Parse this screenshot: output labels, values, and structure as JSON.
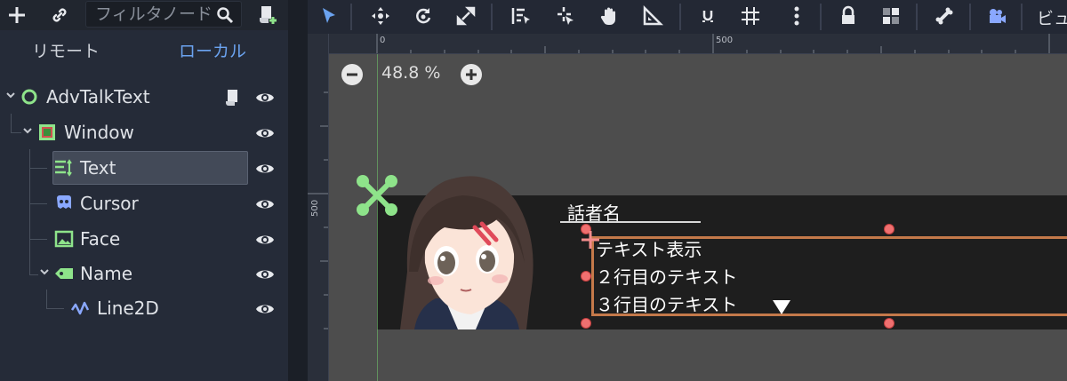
{
  "dock": {
    "filter_placeholder": "フィルタノード",
    "tabs": {
      "remote": "リモート",
      "local": "ローカル"
    },
    "tree": [
      {
        "label": "AdvTalkText",
        "icon": "node-icon"
      },
      {
        "label": "Window",
        "icon": "nine-patch-icon"
      },
      {
        "label": "Text",
        "icon": "rich-text-label-icon"
      },
      {
        "label": "Cursor",
        "icon": "cursor-sprite-icon"
      },
      {
        "label": "Face",
        "icon": "texture-rect-icon"
      },
      {
        "label": "Name",
        "icon": "label-icon"
      },
      {
        "label": "Line2D",
        "icon": "line2d-icon"
      }
    ]
  },
  "viewport": {
    "zoom_label": "48.8 %",
    "toolbar_trailing_label": "ビュ",
    "ruler": {
      "top_0": "0",
      "top_500": "500",
      "left_500": "500"
    }
  },
  "scene": {
    "speaker_name": "話者名",
    "lines": [
      "テキスト表示",
      "２行目のテキスト",
      "３行目のテキスト"
    ]
  },
  "colors": {
    "accent": "#6ba3f0",
    "selection_box": "#c4794a",
    "handle": "#f07070",
    "node_green": "#8ee38a"
  }
}
